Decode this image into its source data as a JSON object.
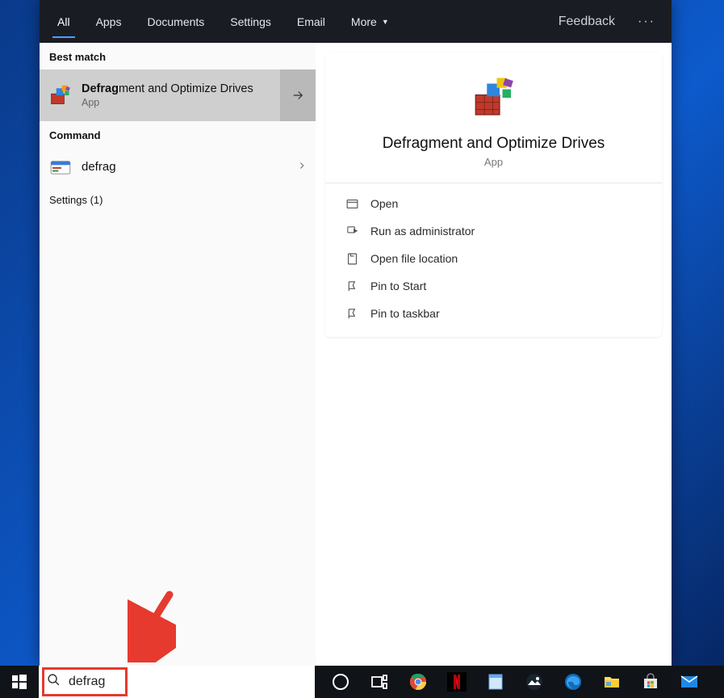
{
  "tabs": {
    "all": "All",
    "apps": "Apps",
    "documents": "Documents",
    "settings": "Settings",
    "email": "Email",
    "more": "More"
  },
  "feedback_label": "Feedback",
  "left": {
    "best_label": "Best match",
    "best_match": {
      "title_bold": "Defrag",
      "title_rest": "ment and Optimize Drives",
      "subtitle": "App"
    },
    "command_label": "Command",
    "command_text": "defrag",
    "settings_label": "Settings (1)"
  },
  "details": {
    "title": "Defragment and Optimize Drives",
    "subtitle": "App",
    "actions": {
      "open": "Open",
      "run_admin": "Run as administrator",
      "open_loc": "Open file location",
      "pin_start": "Pin to Start",
      "pin_taskbar": "Pin to taskbar"
    }
  },
  "search": {
    "value": "defrag"
  },
  "taskbar": {
    "icons": [
      "cortana",
      "taskview",
      "chrome",
      "netflix",
      "notepad",
      "photos",
      "edge",
      "explorer",
      "store",
      "mail"
    ]
  }
}
